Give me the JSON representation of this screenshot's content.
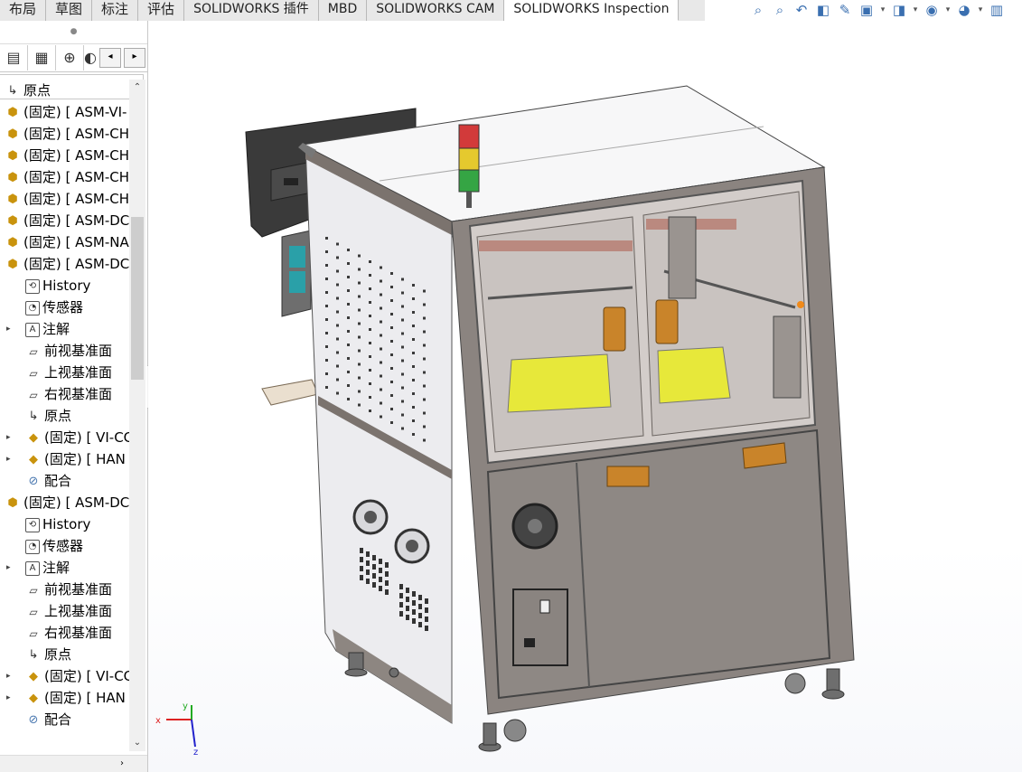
{
  "tabs": [
    {
      "label": "布局",
      "active": false
    },
    {
      "label": "草图",
      "active": false
    },
    {
      "label": "标注",
      "active": false
    },
    {
      "label": "评估",
      "active": false
    },
    {
      "label": "SOLIDWORKS 插件",
      "active": false
    },
    {
      "label": "MBD",
      "active": false
    },
    {
      "label": "SOLIDWORKS CAM",
      "active": false
    },
    {
      "label": "SOLIDWORKS Inspection",
      "active": true
    }
  ],
  "hud": [
    "zoom-to-fit-icon",
    "zoom-area-icon",
    "previous-view-icon",
    "section-view-icon",
    "dynamic-annotation-icon",
    "view-orientation-icon",
    "display-style-icon",
    "hide-show-icon",
    "edit-appearance-icon",
    "apply-scene-icon"
  ],
  "tree": [
    {
      "label": "原点",
      "level": 0,
      "icon": "origin-icon",
      "glyph": "↳",
      "exp": ""
    },
    {
      "label": "(固定) [ ASM-VI-",
      "level": 0,
      "icon": "subassembly-icon",
      "glyph": "⬢",
      "exp": ""
    },
    {
      "label": "(固定) [ ASM-CH",
      "level": 0,
      "icon": "subassembly-icon",
      "glyph": "⬢",
      "exp": ""
    },
    {
      "label": "(固定) [ ASM-CH",
      "level": 0,
      "icon": "subassembly-icon",
      "glyph": "⬢",
      "exp": ""
    },
    {
      "label": "(固定) [ ASM-CH",
      "level": 0,
      "icon": "subassembly-icon",
      "glyph": "⬢",
      "exp": ""
    },
    {
      "label": "(固定) [ ASM-CH",
      "level": 0,
      "icon": "subassembly-icon",
      "glyph": "⬢",
      "exp": ""
    },
    {
      "label": "(固定) [ ASM-DC",
      "level": 0,
      "icon": "subassembly-icon",
      "glyph": "⬢",
      "exp": ""
    },
    {
      "label": "(固定) [ ASM-NA",
      "level": 0,
      "icon": "subassembly-icon",
      "glyph": "⬢",
      "exp": ""
    },
    {
      "label": "(固定) [ ASM-DC",
      "level": 0,
      "icon": "subassembly-icon",
      "glyph": "⬢",
      "exp": ""
    },
    {
      "label": "History",
      "level": 1,
      "icon": "history-icon",
      "glyph": "⟲",
      "exp": ""
    },
    {
      "label": "传感器",
      "level": 1,
      "icon": "sensor-icon",
      "glyph": "◔",
      "exp": ""
    },
    {
      "label": "注解",
      "level": 1,
      "icon": "annotation-icon",
      "glyph": "A",
      "exp": "▸"
    },
    {
      "label": "前视基准面",
      "level": 1,
      "icon": "plane-icon",
      "glyph": "▱",
      "exp": ""
    },
    {
      "label": "上视基准面",
      "level": 1,
      "icon": "plane-icon",
      "glyph": "▱",
      "exp": ""
    },
    {
      "label": "右视基准面",
      "level": 1,
      "icon": "plane-icon",
      "glyph": "▱",
      "exp": ""
    },
    {
      "label": "原点",
      "level": 1,
      "icon": "origin-icon",
      "glyph": "↳",
      "exp": ""
    },
    {
      "label": "(固定) [ VI-CC",
      "level": 1,
      "icon": "part-icon",
      "glyph": "◆",
      "exp": "▸"
    },
    {
      "label": "(固定) [ HAN",
      "level": 1,
      "icon": "part-icon",
      "glyph": "◆",
      "exp": "▸"
    },
    {
      "label": "配合",
      "level": 1,
      "icon": "mates-icon",
      "glyph": "⊘",
      "exp": ""
    },
    {
      "label": "(固定) [ ASM-DC",
      "level": 0,
      "icon": "subassembly-icon",
      "glyph": "⬢",
      "exp": ""
    },
    {
      "label": "History",
      "level": 1,
      "icon": "history-icon",
      "glyph": "⟲",
      "exp": ""
    },
    {
      "label": "传感器",
      "level": 1,
      "icon": "sensor-icon",
      "glyph": "◔",
      "exp": ""
    },
    {
      "label": "注解",
      "level": 1,
      "icon": "annotation-icon",
      "glyph": "A",
      "exp": "▸"
    },
    {
      "label": "前视基准面",
      "level": 1,
      "icon": "plane-icon",
      "glyph": "▱",
      "exp": ""
    },
    {
      "label": "上视基准面",
      "level": 1,
      "icon": "plane-icon",
      "glyph": "▱",
      "exp": ""
    },
    {
      "label": "右视基准面",
      "level": 1,
      "icon": "plane-icon",
      "glyph": "▱",
      "exp": ""
    },
    {
      "label": "原点",
      "level": 1,
      "icon": "origin-icon",
      "glyph": "↳",
      "exp": ""
    },
    {
      "label": "(固定) [ VI-CC",
      "level": 1,
      "icon": "part-icon",
      "glyph": "◆",
      "exp": "▸"
    },
    {
      "label": "(固定) [ HAN",
      "level": 1,
      "icon": "part-icon",
      "glyph": "◆",
      "exp": "▸"
    },
    {
      "label": "配合",
      "level": 1,
      "icon": "mates-icon",
      "glyph": "⊘",
      "exp": ""
    }
  ],
  "triad": {
    "x": "x",
    "y": "y",
    "z": "z"
  },
  "colors": {
    "frame": "#7b736e",
    "panel_white": "#f1f1f3",
    "glass": "#d7d0cc",
    "yellow": "#e7e83a",
    "handle": "#c9842a",
    "base_gray": "#8c8784"
  }
}
